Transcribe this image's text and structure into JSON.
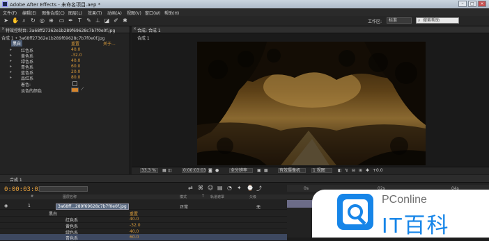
{
  "window": {
    "title": "Adobe After Effects - 未命名项目.aep *",
    "buttons": [
      "–",
      "□",
      "×"
    ]
  },
  "menu": [
    "文件(F)",
    "编辑(E)",
    "图像合成(C)",
    "图层(L)",
    "效果(T)",
    "动画(A)",
    "视图(V)",
    "窗口(W)",
    "帮助(H)"
  ],
  "toolbar": {
    "tools": [
      "selection-tool",
      "hand-tool",
      "zoom-tool",
      "rotate-tool",
      "camera-tool",
      "pan-behind-tool",
      "mask-tool",
      "pen-tool",
      "text-tool",
      "brush-tool",
      "clone-tool",
      "eraser-tool",
      "roto-brush-tool",
      "puppet-tool"
    ],
    "workspace_label": "工作区:",
    "workspace_value": "标准",
    "help_placeholder": "搜索帮助"
  },
  "effect_controls": {
    "tab_label": "特效控制台: 3a68ff27362e1b289f69628c7b7f0e0f.jpg",
    "subheader": "合成 1 • 3a68ff27362e1b289f69628c7b7f0e0f.jpg",
    "effect_name": "黑白",
    "reset": "重置",
    "about": "关于...",
    "params": [
      {
        "name": "红色系",
        "value": "40.0"
      },
      {
        "name": "黄色系",
        "value": "-32.0"
      },
      {
        "name": "绿色系",
        "value": "40.0"
      },
      {
        "name": "青色系",
        "value": "60.0"
      },
      {
        "name": "蓝色系",
        "value": "20.0"
      },
      {
        "name": "品红系",
        "value": "80.0"
      }
    ],
    "tint_label": "着色:",
    "tint_color_label": "淡色的颜色"
  },
  "composition": {
    "tab_label": "合成: 合成 1",
    "inner_tab": "合成 1",
    "footer": {
      "zoom": "33.3 %",
      "timecode": "0:00:03:03",
      "resolution": "全分辨率",
      "camera": "有效摄像机",
      "views": "1 视图",
      "exposure": "+0.0"
    }
  },
  "timeline": {
    "tab_label": "合成 1",
    "timecode": "0:00:03:03",
    "columns": [
      "#",
      "图层名称",
      "模式",
      "T",
      "轨道遮罩",
      "父级"
    ],
    "layer": {
      "index": "1",
      "name": "3a68ff...289f69628c7b7f0e0f.jpg",
      "mode": "正常",
      "parent": "无"
    },
    "rows": [
      {
        "name": "黑白",
        "value": "重置"
      },
      {
        "name": "红色系",
        "value": "40.0"
      },
      {
        "name": "黄色系",
        "value": "-32.0"
      },
      {
        "name": "绿色系",
        "value": "40.0"
      },
      {
        "name": "青色系",
        "value": "60.0"
      }
    ],
    "ruler": [
      "0s",
      "02s",
      "04s"
    ]
  },
  "watermark": {
    "top": "PConline",
    "bottom": "IT百科"
  }
}
